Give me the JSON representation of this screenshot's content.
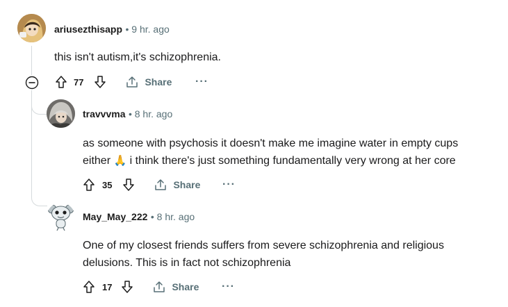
{
  "comments": [
    {
      "username": "ariusezthisapp",
      "time": "• 9 hr. ago",
      "body": "this isn't autism,it's schizophrenia.",
      "votes": "77",
      "share_label": "Share",
      "more_label": "···",
      "avatar_icon": "anime-avatar-icon"
    },
    {
      "username": "travvvma",
      "time": "• 8 hr. ago",
      "body_line1": "as someone with psychosis it doesn't make me imagine water in empty cups",
      "body_line2_a": "either",
      "body_emoji": "🙏",
      "body_line2_b": " i think there's just something fundamentally very wrong at her core",
      "votes": "35",
      "share_label": "Share",
      "more_label": "···",
      "avatar_icon": "grey-haired-avatar-icon"
    },
    {
      "username": "May_May_222",
      "time": "• 8 hr. ago",
      "body_line1": "One of my closest friends suffers from severe schizophrenia and religious",
      "body_line2": "delusions. This is in fact not schizophrenia",
      "votes": "17",
      "share_label": "Share",
      "more_label": "···",
      "avatar_icon": "snoo-avatar-icon"
    }
  ],
  "collapse_icon": "minus-circle-icon",
  "colors": {
    "meta": "#576f76",
    "thread": "#d5dadc",
    "text": "#1a1a1b"
  }
}
